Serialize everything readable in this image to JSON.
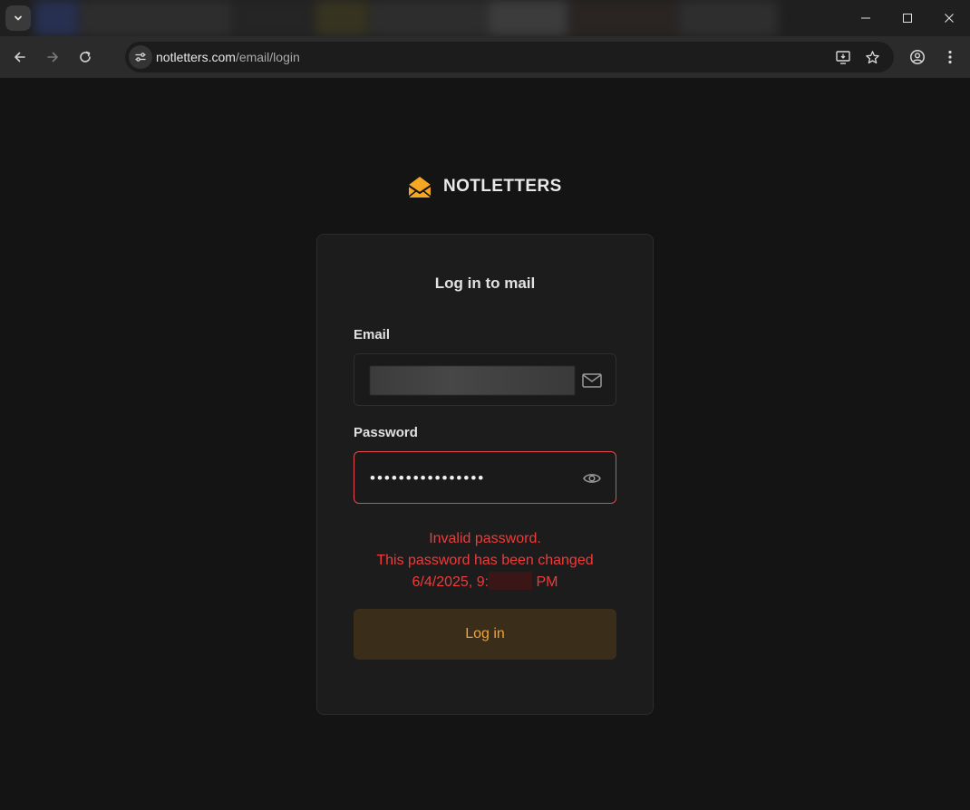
{
  "browser": {
    "url_host": "notletters.com",
    "url_path": "/email/login"
  },
  "page": {
    "brand": "NOTLETTERS",
    "card_title": "Log in to mail",
    "email_label": "Email",
    "email_value": "",
    "password_label": "Password",
    "password_value": "••••••••••••••••",
    "error_line1": "Invalid password.",
    "error_line2": "This password has been changed",
    "error_line3_prefix": "6/4/2025, 9:",
    "error_line3_suffix": "PM",
    "login_button": "Log in"
  },
  "colors": {
    "accent": "#f0a33a",
    "error": "#ef3b3b",
    "background": "#141414"
  },
  "icons": [
    "chevron-down-icon",
    "minimize-icon",
    "maximize-icon",
    "close-icon",
    "back-arrow-icon",
    "forward-arrow-icon",
    "reload-icon",
    "site-settings-icon",
    "install-app-icon",
    "star-icon",
    "profile-icon",
    "more-menu-icon",
    "envelope-logo-icon",
    "mail-icon",
    "eye-icon"
  ]
}
